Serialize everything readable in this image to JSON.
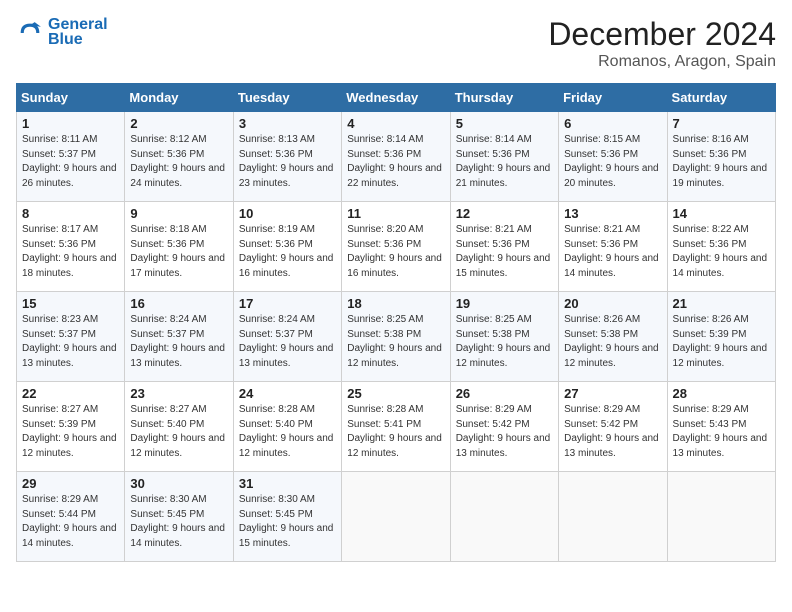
{
  "header": {
    "logo_line1": "General",
    "logo_line2": "Blue",
    "month_title": "December 2024",
    "location": "Romanos, Aragon, Spain"
  },
  "weekdays": [
    "Sunday",
    "Monday",
    "Tuesday",
    "Wednesday",
    "Thursday",
    "Friday",
    "Saturday"
  ],
  "weeks": [
    [
      {
        "day": "1",
        "sunrise": "8:11 AM",
        "sunset": "5:37 PM",
        "daylight": "9 hours and 26 minutes."
      },
      {
        "day": "2",
        "sunrise": "8:12 AM",
        "sunset": "5:36 PM",
        "daylight": "9 hours and 24 minutes."
      },
      {
        "day": "3",
        "sunrise": "8:13 AM",
        "sunset": "5:36 PM",
        "daylight": "9 hours and 23 minutes."
      },
      {
        "day": "4",
        "sunrise": "8:14 AM",
        "sunset": "5:36 PM",
        "daylight": "9 hours and 22 minutes."
      },
      {
        "day": "5",
        "sunrise": "8:14 AM",
        "sunset": "5:36 PM",
        "daylight": "9 hours and 21 minutes."
      },
      {
        "day": "6",
        "sunrise": "8:15 AM",
        "sunset": "5:36 PM",
        "daylight": "9 hours and 20 minutes."
      },
      {
        "day": "7",
        "sunrise": "8:16 AM",
        "sunset": "5:36 PM",
        "daylight": "9 hours and 19 minutes."
      }
    ],
    [
      {
        "day": "8",
        "sunrise": "8:17 AM",
        "sunset": "5:36 PM",
        "daylight": "9 hours and 18 minutes."
      },
      {
        "day": "9",
        "sunrise": "8:18 AM",
        "sunset": "5:36 PM",
        "daylight": "9 hours and 17 minutes."
      },
      {
        "day": "10",
        "sunrise": "8:19 AM",
        "sunset": "5:36 PM",
        "daylight": "9 hours and 16 minutes."
      },
      {
        "day": "11",
        "sunrise": "8:20 AM",
        "sunset": "5:36 PM",
        "daylight": "9 hours and 16 minutes."
      },
      {
        "day": "12",
        "sunrise": "8:21 AM",
        "sunset": "5:36 PM",
        "daylight": "9 hours and 15 minutes."
      },
      {
        "day": "13",
        "sunrise": "8:21 AM",
        "sunset": "5:36 PM",
        "daylight": "9 hours and 14 minutes."
      },
      {
        "day": "14",
        "sunrise": "8:22 AM",
        "sunset": "5:36 PM",
        "daylight": "9 hours and 14 minutes."
      }
    ],
    [
      {
        "day": "15",
        "sunrise": "8:23 AM",
        "sunset": "5:37 PM",
        "daylight": "9 hours and 13 minutes."
      },
      {
        "day": "16",
        "sunrise": "8:24 AM",
        "sunset": "5:37 PM",
        "daylight": "9 hours and 13 minutes."
      },
      {
        "day": "17",
        "sunrise": "8:24 AM",
        "sunset": "5:37 PM",
        "daylight": "9 hours and 13 minutes."
      },
      {
        "day": "18",
        "sunrise": "8:25 AM",
        "sunset": "5:38 PM",
        "daylight": "9 hours and 12 minutes."
      },
      {
        "day": "19",
        "sunrise": "8:25 AM",
        "sunset": "5:38 PM",
        "daylight": "9 hours and 12 minutes."
      },
      {
        "day": "20",
        "sunrise": "8:26 AM",
        "sunset": "5:38 PM",
        "daylight": "9 hours and 12 minutes."
      },
      {
        "day": "21",
        "sunrise": "8:26 AM",
        "sunset": "5:39 PM",
        "daylight": "9 hours and 12 minutes."
      }
    ],
    [
      {
        "day": "22",
        "sunrise": "8:27 AM",
        "sunset": "5:39 PM",
        "daylight": "9 hours and 12 minutes."
      },
      {
        "day": "23",
        "sunrise": "8:27 AM",
        "sunset": "5:40 PM",
        "daylight": "9 hours and 12 minutes."
      },
      {
        "day": "24",
        "sunrise": "8:28 AM",
        "sunset": "5:40 PM",
        "daylight": "9 hours and 12 minutes."
      },
      {
        "day": "25",
        "sunrise": "8:28 AM",
        "sunset": "5:41 PM",
        "daylight": "9 hours and 12 minutes."
      },
      {
        "day": "26",
        "sunrise": "8:29 AM",
        "sunset": "5:42 PM",
        "daylight": "9 hours and 13 minutes."
      },
      {
        "day": "27",
        "sunrise": "8:29 AM",
        "sunset": "5:42 PM",
        "daylight": "9 hours and 13 minutes."
      },
      {
        "day": "28",
        "sunrise": "8:29 AM",
        "sunset": "5:43 PM",
        "daylight": "9 hours and 13 minutes."
      }
    ],
    [
      {
        "day": "29",
        "sunrise": "8:29 AM",
        "sunset": "5:44 PM",
        "daylight": "9 hours and 14 minutes."
      },
      {
        "day": "30",
        "sunrise": "8:30 AM",
        "sunset": "5:45 PM",
        "daylight": "9 hours and 14 minutes."
      },
      {
        "day": "31",
        "sunrise": "8:30 AM",
        "sunset": "5:45 PM",
        "daylight": "9 hours and 15 minutes."
      },
      null,
      null,
      null,
      null
    ]
  ]
}
